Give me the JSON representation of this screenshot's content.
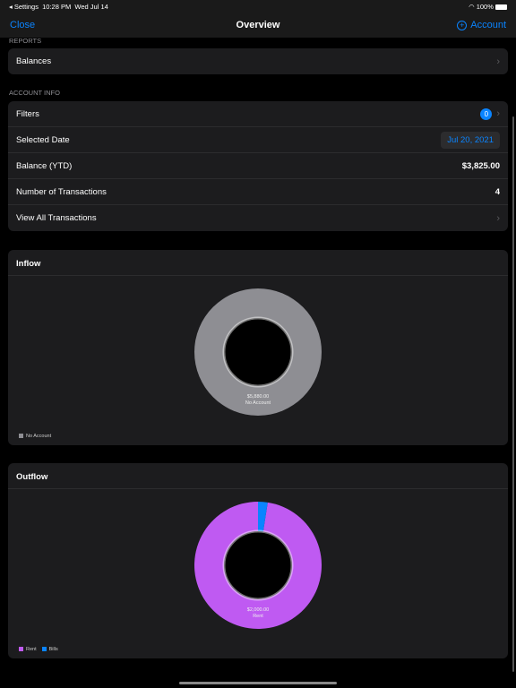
{
  "status": {
    "back": "◂ Settings",
    "time": "10:28 PM",
    "date": "Wed Jul 14",
    "battery": "100%"
  },
  "nav": {
    "close": "Close",
    "title": "Overview",
    "account": "Account"
  },
  "reports": {
    "header": "REPORTS",
    "items": [
      {
        "label": "Balances"
      }
    ]
  },
  "account_info": {
    "header": "ACCOUNT INFO",
    "filters": "Filters",
    "filters_count": "0",
    "selected_date_label": "Selected Date",
    "selected_date": "Jul 20, 2021",
    "balance_label": "Balance (YTD)",
    "balance": "$3,825.00",
    "tx_label": "Number of Transactions",
    "tx_count": "4",
    "view_all": "View All Transactions"
  },
  "chart_data": [
    {
      "type": "pie",
      "title": "Inflow",
      "donut": true,
      "series": [
        {
          "name": "No Account",
          "value": 5880,
          "color": "#8e8e93"
        }
      ],
      "center_label": {
        "value": "$5,880.00",
        "name": "No Account"
      },
      "legend": [
        "No Account"
      ],
      "legend_placement": "bottom-left"
    },
    {
      "type": "pie",
      "title": "Outflow",
      "donut": true,
      "series": [
        {
          "name": "Rent",
          "value": 2000,
          "color": "#bf5af2"
        },
        {
          "name": "Bills",
          "value": 50,
          "color": "#0a84ff"
        }
      ],
      "center_label": {
        "value": "$2,000.00",
        "name": "Rent"
      },
      "legend": [
        "Rent",
        "Bills"
      ],
      "legend_placement": "bottom-left"
    }
  ]
}
